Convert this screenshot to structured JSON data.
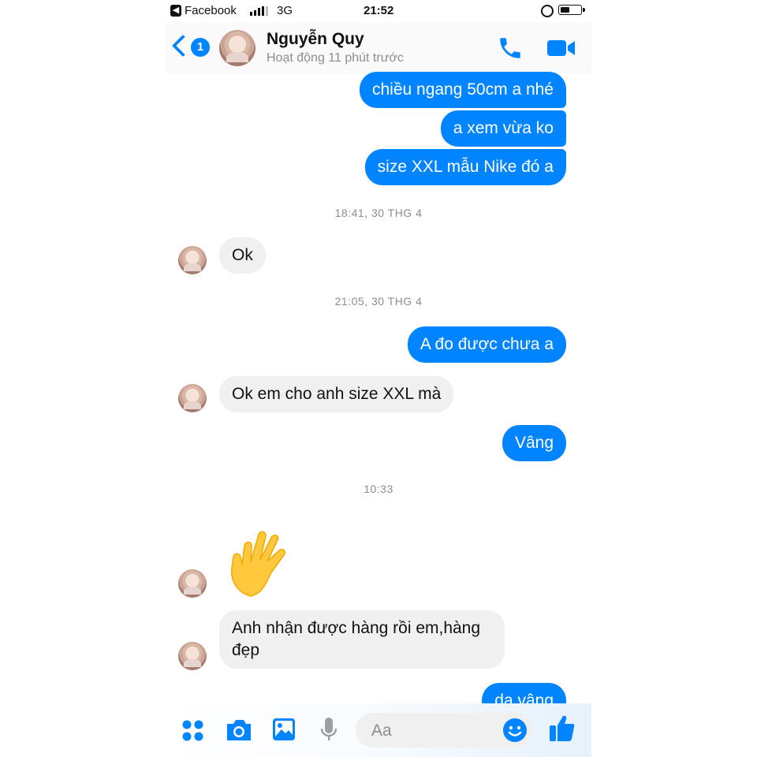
{
  "status_bar": {
    "back_app": "Facebook",
    "network": "3G",
    "time": "21:52",
    "battery_level": 0.45
  },
  "header": {
    "unread_badge": "1",
    "name": "Nguyễn Quy",
    "status": "Hoạt động 11 phút trước"
  },
  "messages": {
    "m1": "chiều ngang 50cm a nhé",
    "m2": "a xem vừa ko",
    "m3": "size XXL mẫu Nike đó a",
    "t1": "18:41, 30 THG 4",
    "m4": "Ok",
    "t2": "21:05, 30 THG 4",
    "m5": "A đo được chưa a",
    "m6": "Ok em cho anh size XXL mà",
    "m7": "Vâng",
    "t3": "10:33",
    "m8_line1": "Anh nhận được hàng rồi em,hàng",
    "m8_line2": "đẹp",
    "m9": "dạ vâng"
  },
  "composer": {
    "placeholder": "Aa"
  },
  "colors": {
    "accent": "#0084ff",
    "incoming_bubble": "#f0f0f0",
    "timestamp": "#8a8d91"
  },
  "icons": [
    "grid-dots-icon",
    "camera-icon",
    "photo-icon",
    "microphone-icon",
    "emoji-icon",
    "thumbs-up-icon",
    "phone-icon",
    "video-icon",
    "waving-hand-icon"
  ]
}
